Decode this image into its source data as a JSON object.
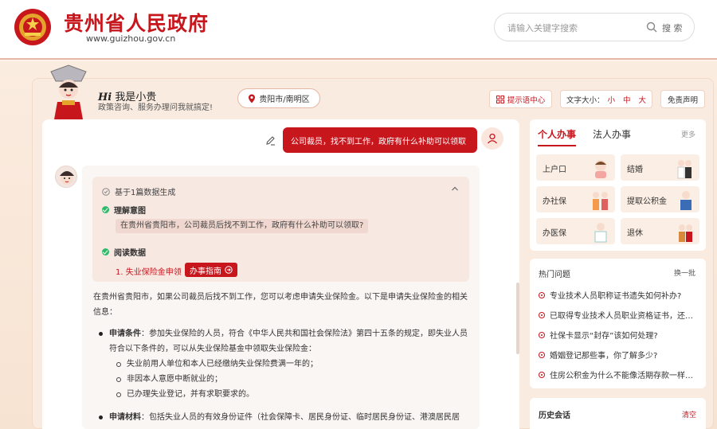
{
  "header": {
    "site_title": "贵州省人民政府",
    "site_url": "www.guizhou.gov.cn",
    "search_placeholder": "请输入关键字搜索",
    "search_label": "搜 索"
  },
  "assistant": {
    "greeting_hi": "Hi",
    "greeting_name": "我是小贵",
    "greeting_sub": "政策咨询、服务办理问我就搞定!",
    "location": "贵阳市/南明区",
    "prompt_center": "提示语中心",
    "font_size_label": "文字大小：",
    "font_sizes": [
      "小",
      "中",
      "大"
    ],
    "disclaimer": "免责声明"
  },
  "chat": {
    "user_message": "公司裁员，找不到工作，政府有什么补助可以领取",
    "source_header": "基于1篇数据生成",
    "understand_label": "理解意图",
    "understand_text": "在贵州省贵阳市，公司裁员后找不到工作，政府有什么补助可以领取?",
    "read_label": "阅读数据",
    "doc_item": "1. 失业保险金申领",
    "guide_button": "办事指南",
    "answer_intro": "在贵州省贵阳市，如果公司裁员后找不到工作，您可以考虑申请失业保险金。以下是申请失业保险金的相关信息：",
    "cond_title": "申请条件",
    "cond_text": "：参加失业保险的人员，符合《中华人民共和国社会保险法》第四十五条的规定，即失业人员符合以下条件的，可以从失业保险基金中领取失业保险金：",
    "cond_items": [
      "失业前用人单位和本人已经缴纳失业保险费满一年的；",
      "非因本人意愿中断就业的；",
      "已办理失业登记，并有求职要求的。"
    ],
    "mat_title": "申请材料",
    "mat_text": "：包括失业人员的有效身份证件（社会保障卡、居民身份证、临时居民身份证、港澳居民居"
  },
  "services": {
    "tab_personal": "个人办事",
    "tab_corporate": "法人办事",
    "more": "更多",
    "cards": [
      "上户口",
      "结婚",
      "办社保",
      "提取公积金",
      "办医保",
      "退休"
    ]
  },
  "hot": {
    "title": "热门问题",
    "refresh": "换一批",
    "items": [
      "专业技术人员职称证书遗失如何补办?",
      "已取得专业技术人员职业资格证书，还…",
      "社保卡显示“封存”该如何处理?",
      "婚姻登记那些事，你了解多少?",
      "住房公积金为什么不能像活期存款一样…"
    ]
  },
  "history": {
    "title": "历史会话",
    "clear": "清空"
  },
  "colors": {
    "brand_red": "#c8161d",
    "success_green": "#2dbb6a"
  }
}
